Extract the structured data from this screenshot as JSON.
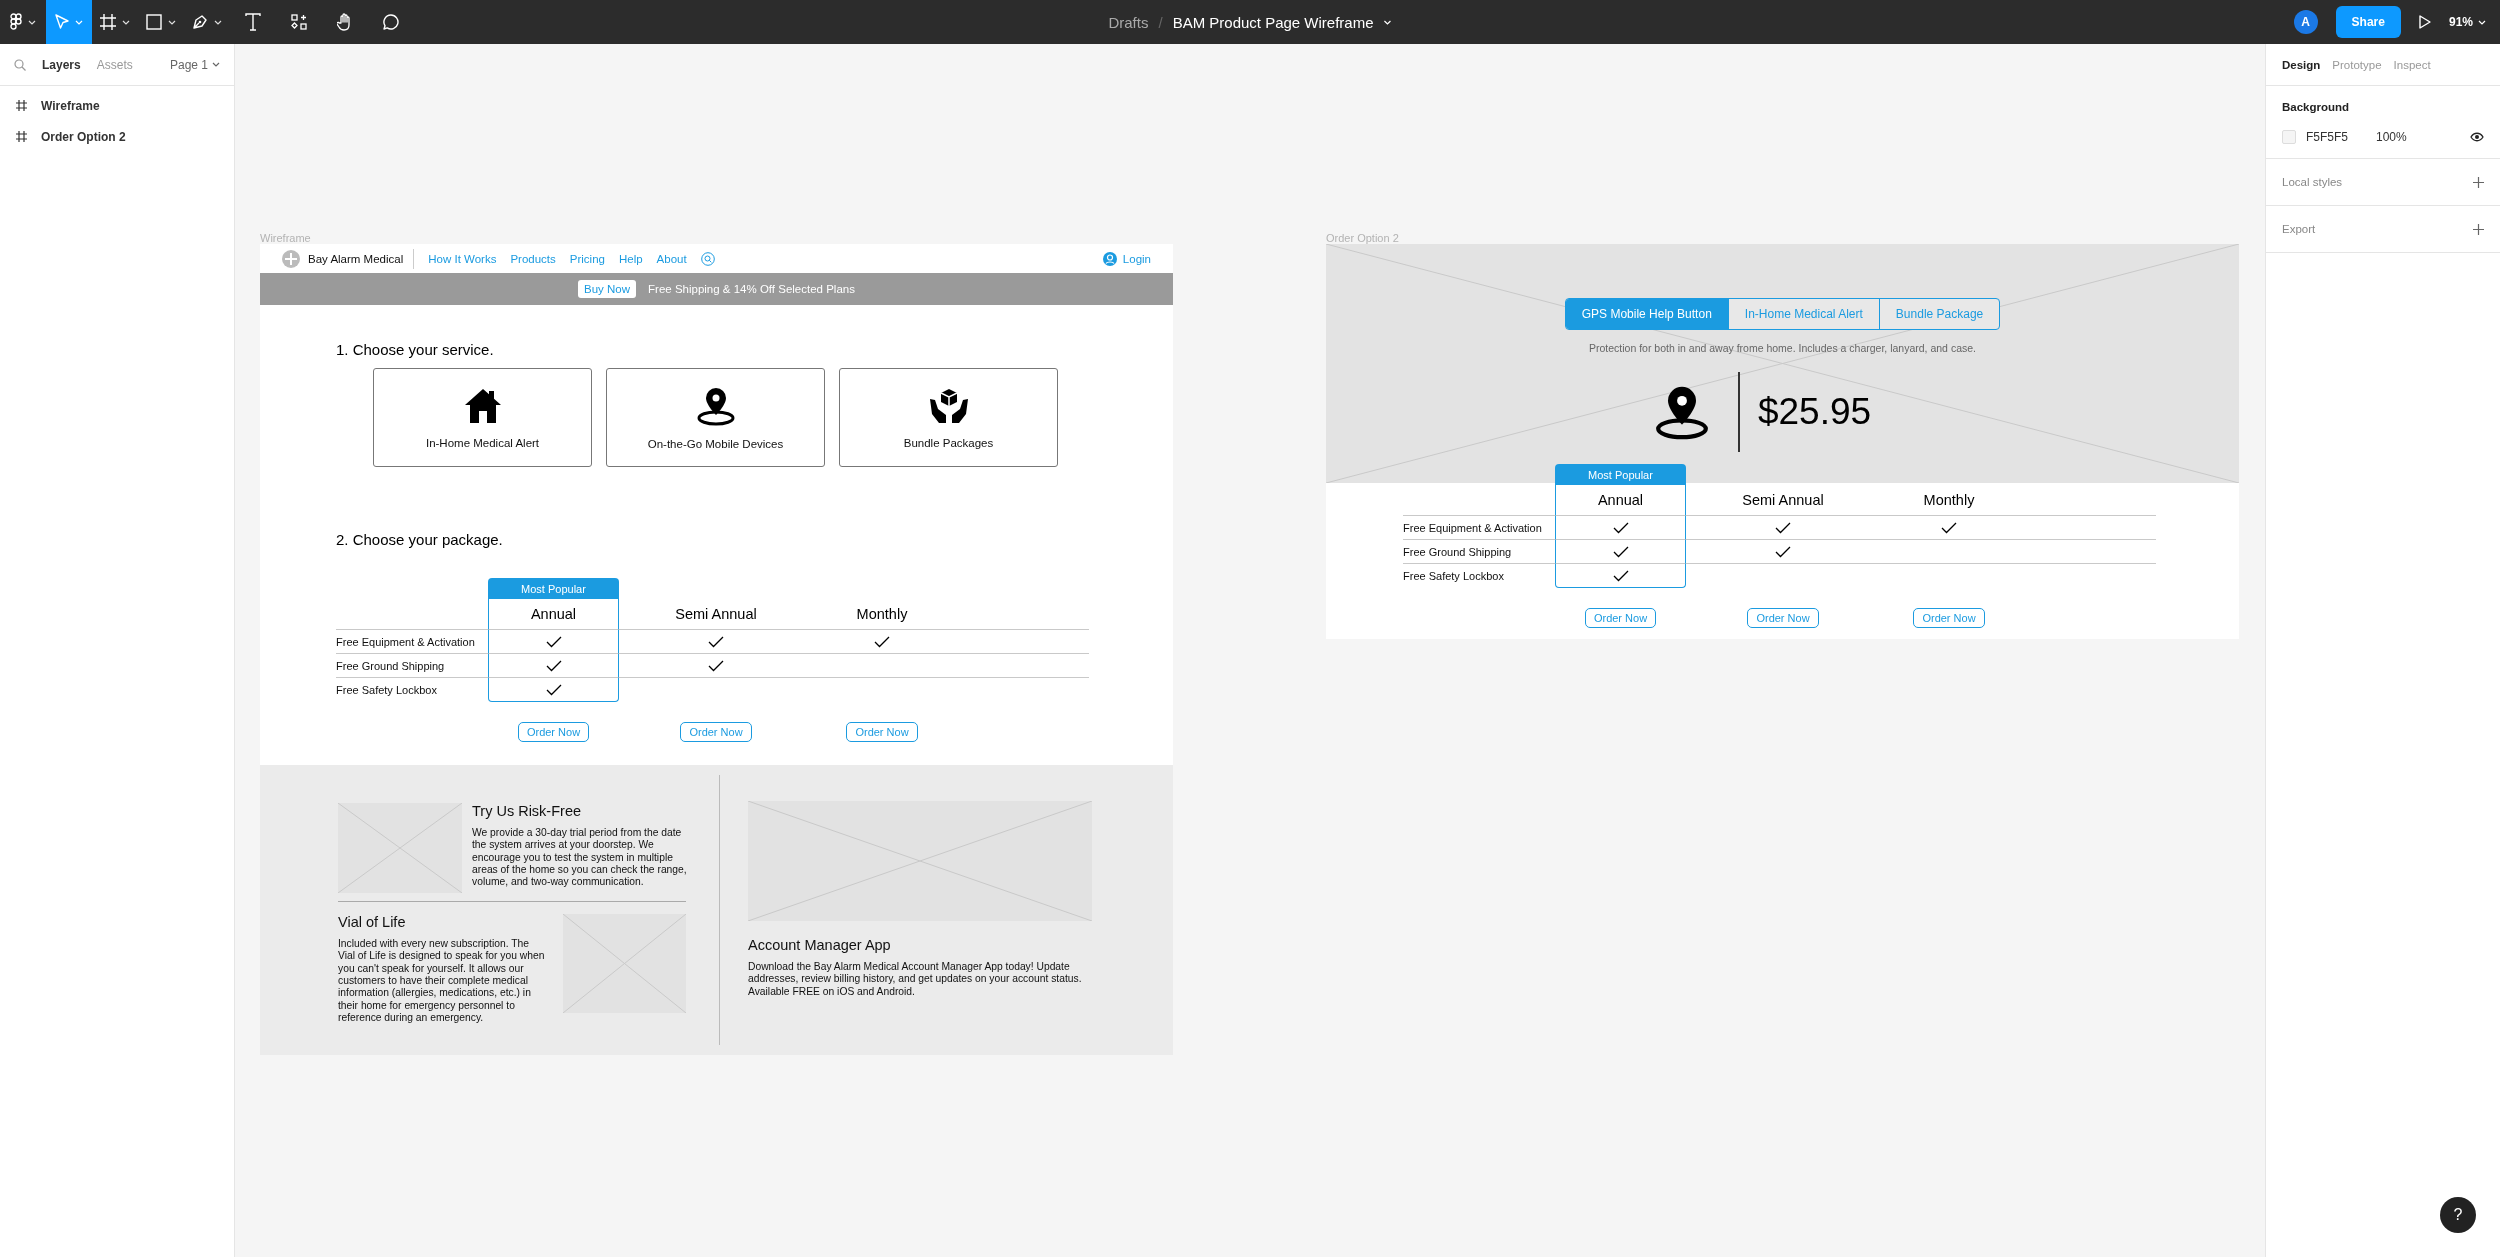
{
  "toolbar": {
    "tools": [
      {
        "kind": "main-menu",
        "selected": false
      },
      {
        "kind": "move",
        "selected": true
      },
      {
        "kind": "frame",
        "selected": false
      },
      {
        "kind": "shape",
        "selected": false
      },
      {
        "kind": "pen",
        "selected": false
      },
      {
        "kind": "text",
        "selected": false
      },
      {
        "kind": "components",
        "selected": false
      },
      {
        "kind": "hand",
        "selected": false
      },
      {
        "kind": "comment",
        "selected": false
      }
    ],
    "breadcrumb": {
      "folder": "Drafts",
      "separator": "/",
      "file": "BAM Product Page Wireframe"
    },
    "avatar": "A",
    "share": "Share",
    "zoom": "91%"
  },
  "left_panel": {
    "tabs": [
      {
        "label": "Layers",
        "selected": true
      },
      {
        "label": "Assets",
        "selected": false
      }
    ],
    "page": "Page 1",
    "layers": [
      "Wireframe",
      "Order Option 2"
    ]
  },
  "wireframe": {
    "label": "Wireframe",
    "nav": {
      "brand": "Bay Alarm Medical",
      "links": [
        "How It Works",
        "Products",
        "Pricing",
        "Help",
        "About"
      ],
      "login": "Login"
    },
    "promo": {
      "button": "Buy Now",
      "text": "Free Shipping & 14% Off Selected Plans"
    },
    "service": {
      "heading": "1. Choose your service.",
      "cards": [
        {
          "kind": "home",
          "label": "In-Home Medical Alert"
        },
        {
          "kind": "pin",
          "label": "On-the-Go Mobile Devices"
        },
        {
          "kind": "bundle",
          "label": "Bundle Packages"
        }
      ]
    },
    "package": {
      "heading": "2. Choose your package.",
      "table": {
        "plans": [
          {
            "name": "Annual",
            "badge": "Most Popular",
            "highlighted": true,
            "button": "Order Now"
          },
          {
            "name": "Semi Annual",
            "highlighted": false,
            "button": "Order Now"
          },
          {
            "name": "Monthly",
            "highlighted": false,
            "button": "Order Now"
          }
        ],
        "rows": [
          {
            "label": "Free Equipment & Activation",
            "checks": [
              true,
              true,
              true
            ]
          },
          {
            "label": "Free Ground Shipping",
            "checks": [
              true,
              true,
              false
            ]
          },
          {
            "label": "Free Safety Lockbox",
            "checks": [
              true,
              false,
              false
            ]
          }
        ]
      }
    },
    "features": {
      "left": [
        {
          "kind": "image-left",
          "title": "Try Us Risk-Free",
          "text": "We provide a 30-day trial period from the date the system arrives at your doorstep. We encourage you to test the system in multiple areas of the home so you can check the range, volume, and two-way communication."
        },
        {
          "kind": "image-right",
          "title": "Vial of Life",
          "text": "Included with every new subscription. The Vial of Life is designed to speak for you when you can't speak for yourself. It allows our customers to have their complete medical information (allergies, medications, etc.) in their home for emergency personnel to reference during an emergency."
        }
      ],
      "right": {
        "title": "Account Manager App",
        "text": "Download the Bay Alarm Medical Account Manager App today! Update addresses, review billing history, and get updates on your account status. Available FREE on iOS and Android."
      }
    }
  },
  "order_option_2": {
    "label": "Order Option 2",
    "tabs": [
      {
        "label": "GPS Mobile Help Button",
        "selected": true
      },
      {
        "label": "In-Home Medical Alert",
        "selected": false
      },
      {
        "label": "Bundle Package",
        "selected": false
      }
    ],
    "description": "Protection for both in and away frome home. Includes a charger, lanyard, and case.",
    "price": "$25.95",
    "table": {
      "plans": [
        {
          "name": "Annual",
          "badge": "Most Popular",
          "highlighted": true,
          "button": "Order Now"
        },
        {
          "name": "Semi Annual",
          "highlighted": false,
          "button": "Order Now"
        },
        {
          "name": "Monthly",
          "highlighted": false,
          "button": "Order Now"
        }
      ],
      "rows": [
        {
          "label": "Free Equipment & Activation",
          "checks": [
            true,
            true,
            true
          ]
        },
        {
          "label": "Free Ground Shipping",
          "checks": [
            true,
            true,
            false
          ]
        },
        {
          "label": "Free Safety Lockbox",
          "checks": [
            true,
            false,
            false
          ]
        }
      ]
    }
  },
  "right_panel": {
    "tabs": [
      {
        "label": "Design",
        "selected": true
      },
      {
        "label": "Prototype",
        "selected": false
      },
      {
        "label": "Inspect",
        "selected": false
      }
    ],
    "background": {
      "title": "Background",
      "hex": "F5F5F5",
      "opacity": "100%"
    },
    "sections": [
      "Local styles",
      "Export"
    ]
  },
  "help": "?"
}
